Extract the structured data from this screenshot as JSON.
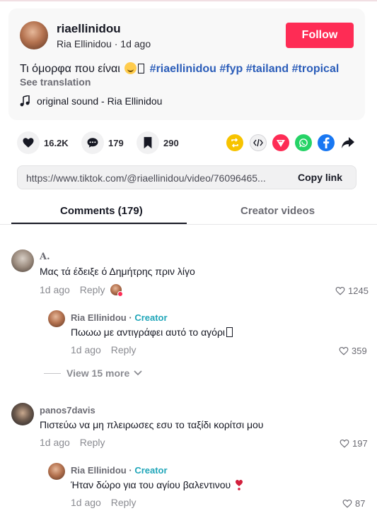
{
  "post": {
    "username": "riaellinidou",
    "display_name": "Ria Ellinidou",
    "time": "1d ago",
    "follow_label": "Follow",
    "caption_text": "Τι όμορφα που είναι",
    "hashtags": "#riaellinidou #fyp #tailand #tropical",
    "see_translation": "See translation",
    "sound": "original sound - Ria Ellinidou"
  },
  "actions": {
    "likes": "16.2K",
    "comments": "179",
    "saves": "290"
  },
  "share": {
    "link_url": "https://www.tiktok.com/@riaellinidou/video/76096465...",
    "copy_label": "Copy link"
  },
  "tabs": {
    "comments": "Comments (179)",
    "creator_videos": "Creator videos"
  },
  "comments": [
    {
      "name": "A.",
      "text": "Μας τά έδειξε ό Δημήτρης πριν λίγο",
      "time": "1d ago",
      "reply_label": "Reply",
      "likes": "1245",
      "reply": {
        "name": "Ria Ellinidou",
        "creator_label": "Creator",
        "text": "Πωωω με αντιγράφει αυτό το αγόρι",
        "time": "1d ago",
        "reply_label": "Reply",
        "likes": "359"
      },
      "view_more": "View 15 more"
    },
    {
      "name": "panos7davis",
      "text": "Πιστεύω να μη πλειρωσες εσυ το ταξίδι κορίτσι μου",
      "time": "1d ago",
      "reply_label": "Reply",
      "likes": "197",
      "reply": {
        "name": "Ria Ellinidou",
        "creator_label": "Creator",
        "text": "Ήταν δώρο για του αγίου βαλεντινου",
        "time": "1d ago",
        "reply_label": "Reply",
        "likes": "87"
      }
    }
  ]
}
